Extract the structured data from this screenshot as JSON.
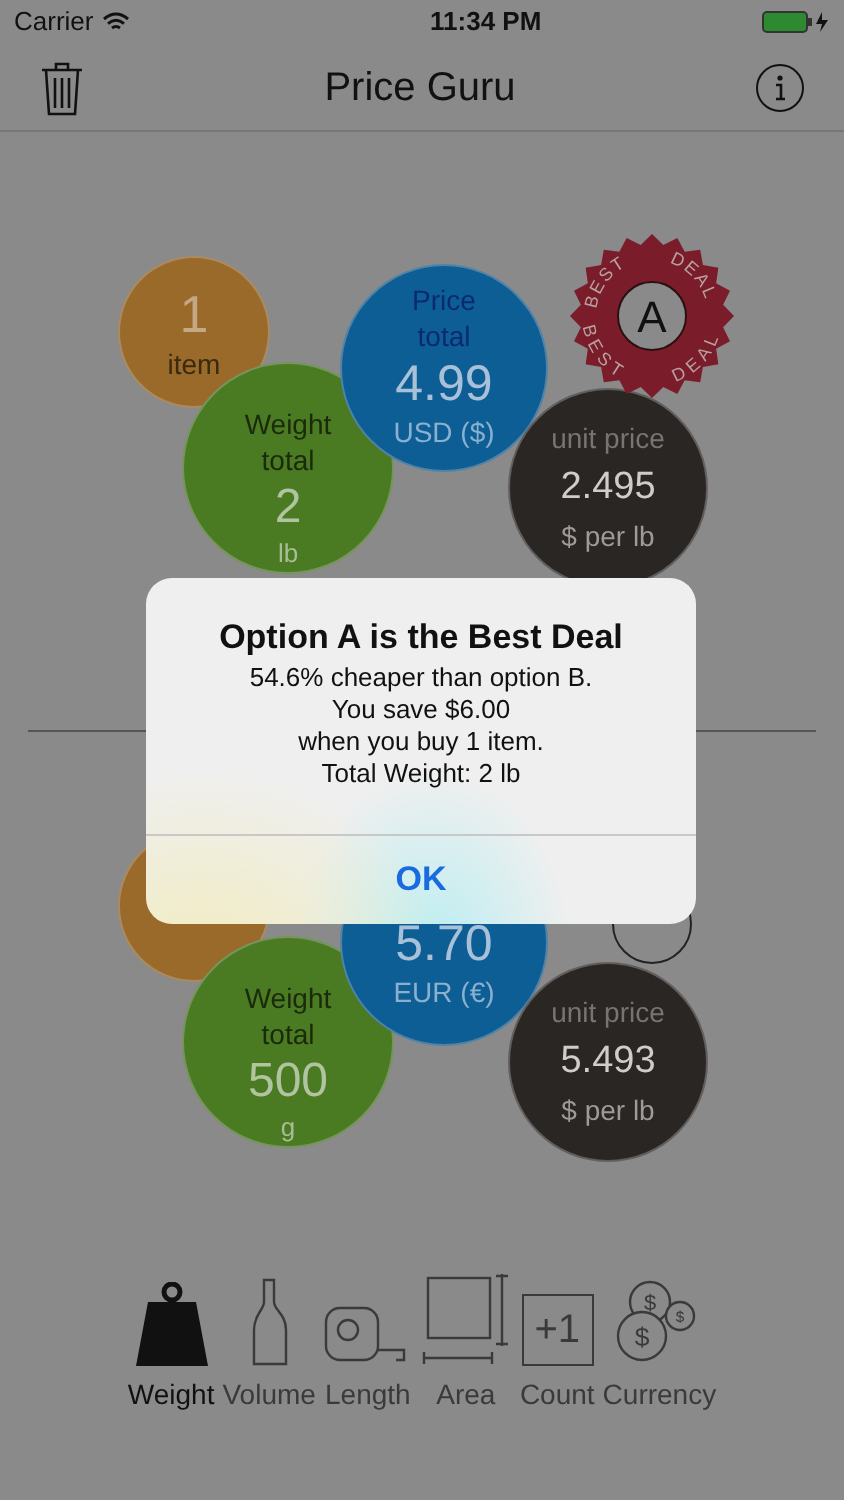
{
  "status_bar": {
    "carrier": "Carrier",
    "time": "11:34 PM"
  },
  "nav": {
    "title": "Price Guru"
  },
  "options": [
    {
      "count": "1",
      "count_unit": "item",
      "weight_label": "Weight total",
      "weight": "2",
      "weight_unit": "lb",
      "price_label": "Price total",
      "price": "4.99",
      "currency": "USD ($)",
      "unit_price_label": "unit price",
      "unit_price": "2.495",
      "unit_price_unit": "$ per lb",
      "badge": {
        "letter": "A",
        "words": [
          "BEST",
          "DEAL",
          "BEST",
          "DEAL"
        ]
      }
    },
    {
      "weight_label": "Weight total",
      "weight": "500",
      "weight_unit": "g",
      "price": "5.70",
      "currency": "EUR (€)",
      "unit_price_label": "unit price",
      "unit_price": "5.493",
      "unit_price_unit": "$ per lb"
    }
  ],
  "alert": {
    "title": "Option A is the Best Deal",
    "lines": [
      "54.6% cheaper than option B.",
      "You save $6.00",
      "when you buy 1 item.",
      "Total Weight: 2 lb"
    ],
    "button": "OK"
  },
  "tabs": [
    {
      "kind": "weight",
      "label": "Weight",
      "selected": true
    },
    {
      "kind": "volume",
      "label": "Volume",
      "selected": false
    },
    {
      "kind": "length",
      "label": "Length",
      "selected": false
    },
    {
      "kind": "area",
      "label": "Area",
      "selected": false
    },
    {
      "kind": "count",
      "label": "Count",
      "selected": false,
      "icon_text": "+1"
    },
    {
      "kind": "currency",
      "label": "Currency",
      "selected": false,
      "icon_texts": [
        "$",
        "$",
        "$"
      ]
    }
  ]
}
